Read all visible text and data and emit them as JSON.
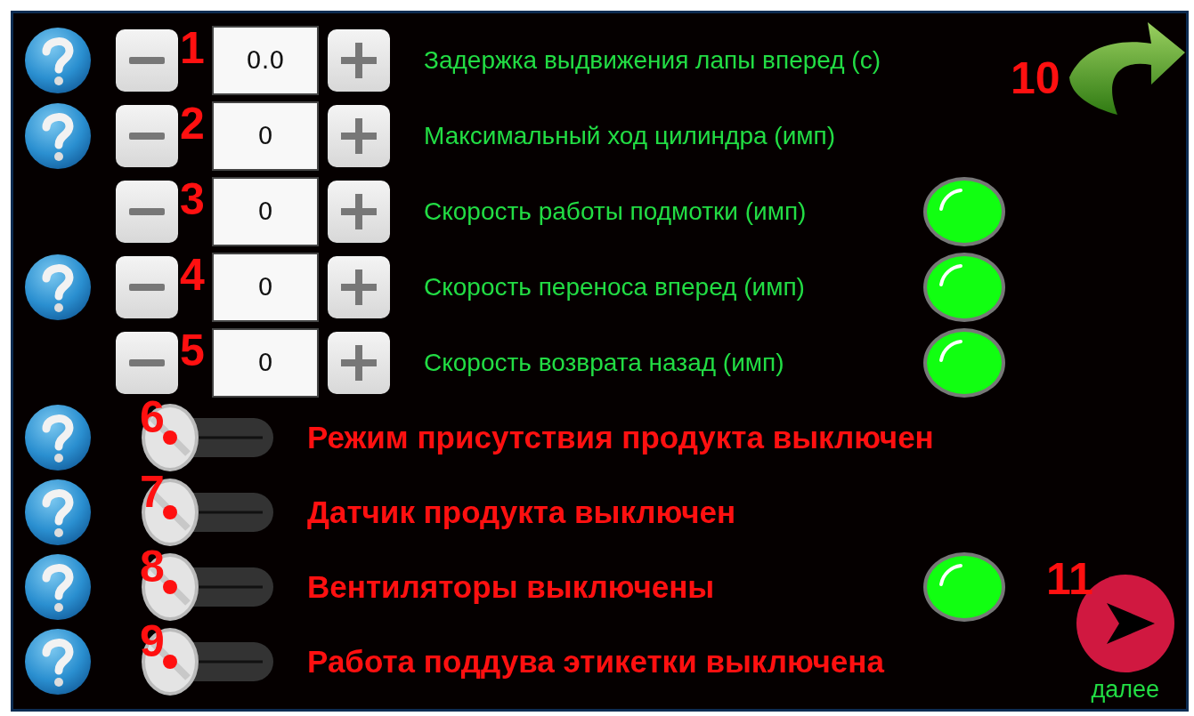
{
  "numeric_rows": [
    {
      "help": true,
      "marker": "1",
      "value": "0.0",
      "label": "Задержка выдвижения лапы вперед (с)",
      "lamp": false
    },
    {
      "help": true,
      "marker": "2",
      "value": "0",
      "label": "Максимальный ход цилиндра (имп)",
      "lamp": false
    },
    {
      "help": false,
      "marker": "3",
      "value": "0",
      "label": "Скорость работы подмотки (имп)",
      "lamp": true
    },
    {
      "help": true,
      "marker": "4",
      "value": "0",
      "label": "Скорость переноса вперед (имп)",
      "lamp": true
    },
    {
      "help": false,
      "marker": "5",
      "value": "0",
      "label": "Скорость возврата назад (имп)",
      "lamp": true
    }
  ],
  "toggle_rows": [
    {
      "help": true,
      "marker": "6",
      "on": false,
      "label": "Режим присутствия продукта выключен",
      "lamp": false
    },
    {
      "help": true,
      "marker": "7",
      "on": false,
      "label": "Датчик продукта выключен",
      "lamp": false
    },
    {
      "help": true,
      "marker": "8",
      "on": false,
      "label": "Вентиляторы выключены",
      "lamp": true
    },
    {
      "help": true,
      "marker": "9",
      "on": false,
      "label": "Работа поддува этикетки выключена",
      "lamp": false
    }
  ],
  "back": {
    "marker": "10"
  },
  "next": {
    "marker": "11",
    "label": "далее"
  }
}
